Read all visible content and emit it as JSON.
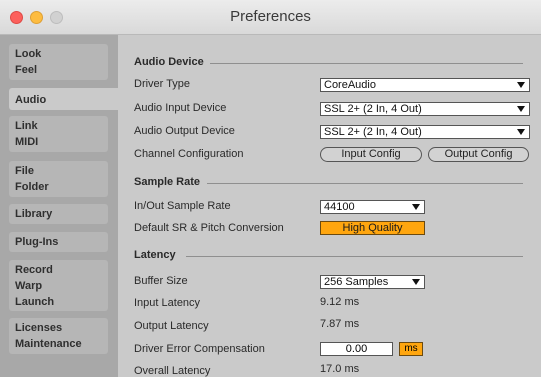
{
  "window": {
    "title": "Preferences"
  },
  "sidebar": {
    "tabs": [
      {
        "lines": [
          "Look",
          "Feel"
        ]
      },
      {
        "lines": [
          "Audio"
        ]
      },
      {
        "lines": [
          "Link",
          "MIDI"
        ]
      },
      {
        "lines": [
          "File",
          "Folder"
        ]
      },
      {
        "lines": [
          "Library"
        ]
      },
      {
        "lines": [
          "Plug-Ins"
        ]
      },
      {
        "lines": [
          "Record",
          "Warp",
          "Launch"
        ]
      },
      {
        "lines": [
          "Licenses",
          "Maintenance"
        ]
      }
    ],
    "active": "Audio"
  },
  "audio_device": {
    "heading": "Audio Device",
    "driver_type": {
      "label": "Driver Type",
      "value": "CoreAudio"
    },
    "input_device": {
      "label": "Audio Input Device",
      "value": "SSL 2+ (2 In, 4 Out)"
    },
    "output_device": {
      "label": "Audio Output Device",
      "value": "SSL 2+ (2 In, 4 Out)"
    },
    "channel_config": {
      "label": "Channel Configuration",
      "input_button": "Input Config",
      "output_button": "Output Config"
    }
  },
  "sample_rate": {
    "heading": "Sample Rate",
    "in_out": {
      "label": "In/Out Sample Rate",
      "value": "44100"
    },
    "conversion": {
      "label": "Default SR & Pitch Conversion",
      "value": "High Quality"
    }
  },
  "latency": {
    "heading": "Latency",
    "buffer_size": {
      "label": "Buffer Size",
      "value": "256 Samples"
    },
    "input_latency": {
      "label": "Input Latency",
      "value": "9.12 ms"
    },
    "output_latency": {
      "label": "Output Latency",
      "value": "7.87 ms"
    },
    "driver_error": {
      "label": "Driver Error Compensation",
      "value": "0.00",
      "unit": "ms"
    },
    "overall": {
      "label": "Overall Latency",
      "value": "17.0 ms"
    }
  },
  "colors": {
    "accent": "#ffa60f",
    "panel": "#cacaca",
    "sidebar": "#a8a8a8"
  }
}
